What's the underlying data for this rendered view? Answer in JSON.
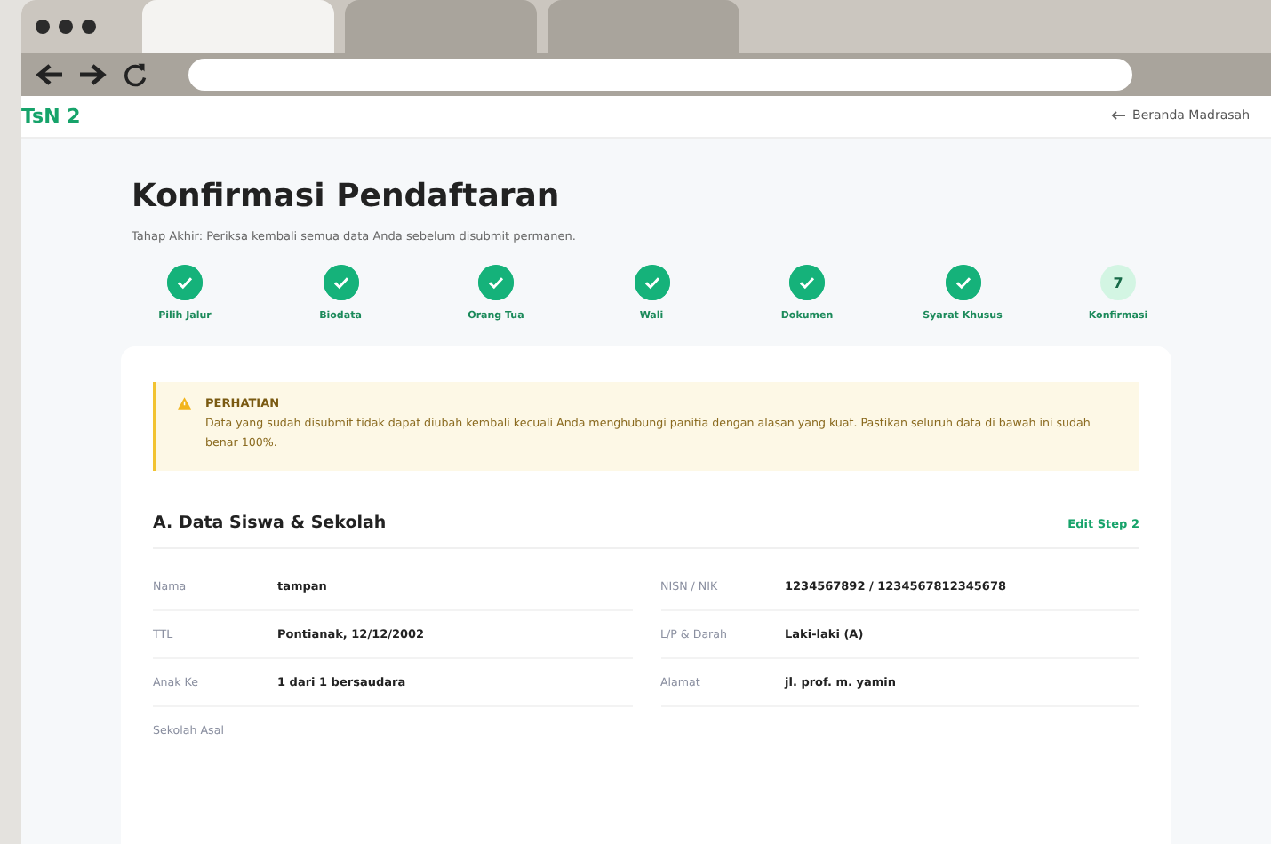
{
  "browser": {
    "tabs": [
      {
        "selected": true
      },
      {
        "selected": false
      },
      {
        "selected": false
      }
    ]
  },
  "header": {
    "logo": "TsN 2",
    "back_link": "Beranda Madrasah"
  },
  "title": "Konfirmasi Pendaftaran",
  "subtitle": "Tahap Akhir: Periksa kembali semua data Anda sebelum disubmit permanen.",
  "steps": [
    {
      "label": "Pilih Jalur",
      "done": true
    },
    {
      "label": "Biodata",
      "done": true
    },
    {
      "label": "Orang Tua",
      "done": true
    },
    {
      "label": "Wali",
      "done": true
    },
    {
      "label": "Dokumen",
      "done": true
    },
    {
      "label": "Syarat Khusus",
      "done": true
    },
    {
      "label": "Konfirmasi",
      "done": false,
      "number": "7"
    }
  ],
  "alert": {
    "title": "PERHATIAN",
    "text": "Data yang sudah disubmit tidak dapat diubah kembali kecuali Anda menghubungi panitia dengan alasan yang kuat. Pastikan seluruh data di bawah ini sudah benar 100%."
  },
  "section": {
    "title": "A. Data Siswa & Sekolah",
    "edit_link": "Edit Step 2",
    "fields": [
      {
        "label": "Nama",
        "value": "tampan"
      },
      {
        "label": "NISN / NIK",
        "value": "1234567892 / 1234567812345678"
      },
      {
        "label": "TTL",
        "value": "Pontianak, 12/12/2002"
      },
      {
        "label": "L/P & Darah",
        "value": "Laki-laki (A)"
      },
      {
        "label": "Anak Ke",
        "value": "1 dari 1 bersaudara"
      },
      {
        "label": "Alamat",
        "value": "jl. prof. m. yamin"
      }
    ],
    "school_label": "Sekolah Asal"
  }
}
